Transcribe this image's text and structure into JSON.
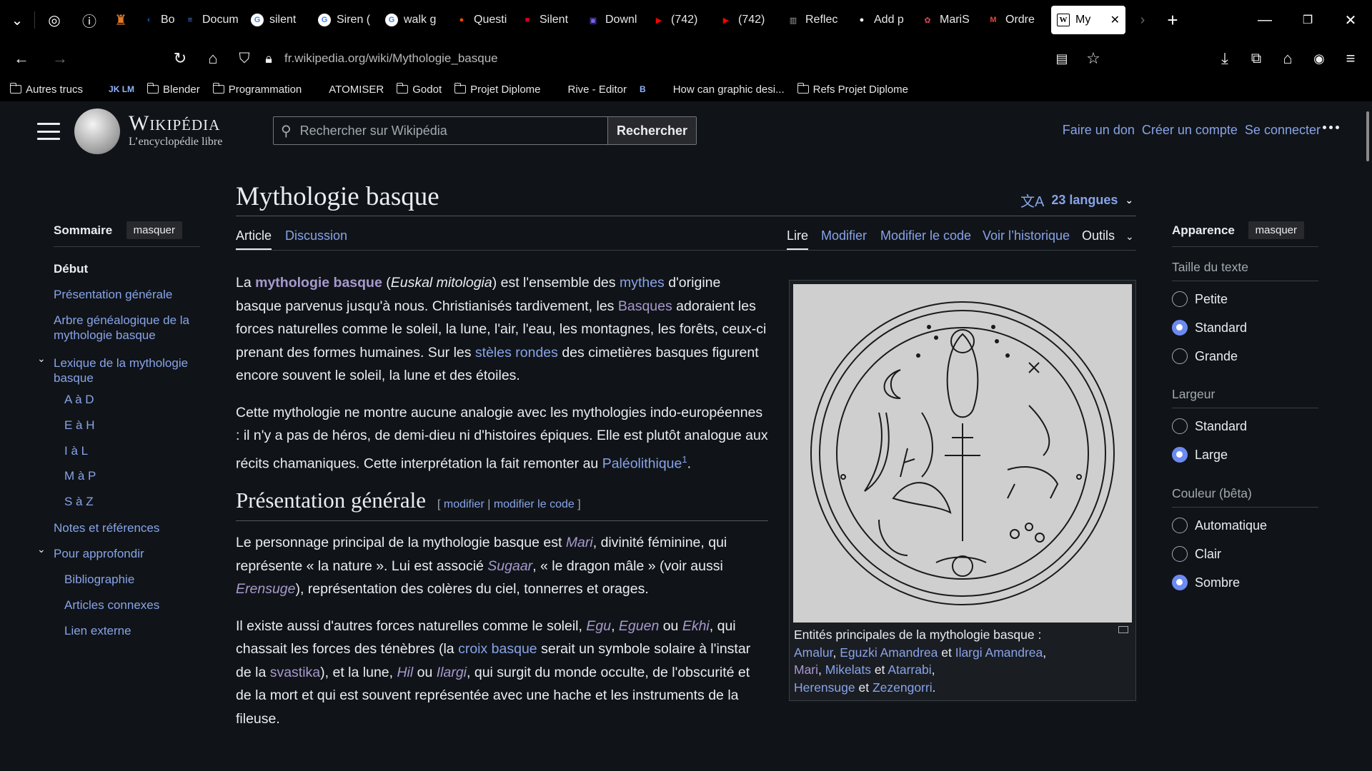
{
  "browser": {
    "tabs": [
      {
        "label": "Bo",
        "icon": "chevron-left-icon",
        "color": "#1a73e8"
      },
      {
        "label": "Docum",
        "icon": "docs-icon",
        "color": "#4285f4"
      },
      {
        "label": "silent",
        "icon": "google-icon",
        "color": "#ffffff"
      },
      {
        "label": "Siren (",
        "icon": "google-icon",
        "color": "#ffffff"
      },
      {
        "label": "walk g",
        "icon": "google-icon",
        "color": "#ffffff"
      },
      {
        "label": "Questi",
        "icon": "reddit-icon",
        "color": "#ff4500"
      },
      {
        "label": "Silent",
        "icon": "red-square-icon",
        "color": "#d0021b"
      },
      {
        "label": "Downl",
        "icon": "download-site-icon",
        "color": "#7b61ff"
      },
      {
        "label": "(742)",
        "icon": "youtube-icon",
        "color": "#ff0000"
      },
      {
        "label": "(742) ",
        "icon": "youtube-icon",
        "color": "#ff0000"
      },
      {
        "label": "Reflec",
        "icon": "reflect-icon",
        "color": "#9aa0a6"
      },
      {
        "label": "Add p",
        "icon": "github-icon",
        "color": "#ffffff"
      },
      {
        "label": "MariS",
        "icon": "flower-icon",
        "color": "#e04b5a"
      },
      {
        "label": "Ordre",
        "icon": "gmail-icon",
        "color": "#ea4335"
      }
    ],
    "active_tab": {
      "label": "My",
      "icon": "wikipedia-icon"
    },
    "url_domain": "fr.wikipedia.org",
    "url_path": "/wiki/Mythologie_basque",
    "bookmarks": [
      {
        "label": "Autres trucs",
        "type": "folder"
      },
      {
        "label": "",
        "type": "icon"
      },
      {
        "label": "JK LM",
        "type": "icon"
      },
      {
        "label": "Blender",
        "type": "folder"
      },
      {
        "label": "Programmation",
        "type": "folder"
      },
      {
        "label": "ATOMISER",
        "type": "link"
      },
      {
        "label": "Godot",
        "type": "folder"
      },
      {
        "label": "Projet Diplome",
        "type": "folder"
      },
      {
        "label": "Rive - Editor",
        "type": "link"
      },
      {
        "label": "B",
        "type": "icon"
      },
      {
        "label": "How can graphic desi...",
        "type": "link"
      },
      {
        "label": "Refs Projet Diplome",
        "type": "folder"
      }
    ]
  },
  "wiki": {
    "wordmark": "Wikipédia",
    "tagline": "L’encyclopédie libre",
    "search_placeholder": "Rechercher sur Wikipédia",
    "search_button": "Rechercher",
    "user_links": [
      "Faire un don",
      "Créer un compte",
      "Se connecter"
    ]
  },
  "toc": {
    "title": "Sommaire",
    "hide": "masquer",
    "items": [
      {
        "label": "Début",
        "level": 0,
        "current": true
      },
      {
        "label": "Présentation générale",
        "level": 0
      },
      {
        "label": "Arbre généalogique de la mythologie basque",
        "level": 0
      },
      {
        "label": "Lexique de la mythologie basque",
        "level": 0,
        "expandable": true
      },
      {
        "label": "A à D",
        "level": 1
      },
      {
        "label": "E à H",
        "level": 1
      },
      {
        "label": "I à L",
        "level": 1
      },
      {
        "label": "M à P",
        "level": 1
      },
      {
        "label": "S à Z",
        "level": 1
      },
      {
        "label": "Notes et références",
        "level": 0
      },
      {
        "label": "Pour approfondir",
        "level": 0,
        "expandable": true
      },
      {
        "label": "Bibliographie",
        "level": 1
      },
      {
        "label": "Articles connexes",
        "level": 1
      },
      {
        "label": "Lien externe",
        "level": 1
      }
    ]
  },
  "article": {
    "title": "Mythologie basque",
    "languages": "23 langues",
    "tabs_left": [
      "Article",
      "Discussion"
    ],
    "tabs_right": [
      "Lire",
      "Modifier",
      "Modifier le code",
      "Voir l’historique",
      "Outils"
    ],
    "p1": {
      "a": "La ",
      "b": "mythologie basque",
      "c": " (",
      "d": "Euskal mitologia",
      "e": ") est l'ensemble des ",
      "f": "mythes",
      "g": " d'origine basque parvenus jusqu'à nous. Christianisés tardivement, les ",
      "h": "Basques",
      "i": " adoraient les forces naturelles comme le soleil, la lune, l'air, l'eau, les montagnes, les forêts, ceux-ci prenant des formes humaines. Sur les ",
      "j": "stèles rondes",
      "k": " des cimetières basques figurent encore souvent le soleil, la lune et des étoiles."
    },
    "p2": {
      "a": "Cette mythologie ne montre aucune analogie avec les mythologies indo-européennes : il n'y a pas de héros, de demi-dieu ni d'histoires épiques. Elle est plutôt analogue aux récits chamaniques. Cette interprétation la fait remonter au ",
      "b": "Paléolithique",
      "c": "1",
      "d": "."
    },
    "section": {
      "title": "Présentation générale",
      "edit_open": "[ ",
      "edit1": "modifier",
      "edit_sep": " | ",
      "edit2": "modifier le code",
      "edit_close": " ]"
    },
    "p3": {
      "a": "Le personnage principal de la mythologie basque est ",
      "b": "Mari",
      "c": ", divinité féminine, qui représente « la nature ». Lui est associé ",
      "d": "Sugaar",
      "e": ", « le dragon mâle » (voir aussi ",
      "f": "Erensuge",
      "g": "), représentation des colères du ciel, tonnerres et orages."
    },
    "p4": {
      "a": "Il existe aussi d'autres forces naturelles comme le soleil, ",
      "b": "Egu",
      "c": ", ",
      "d": "Eguen",
      "e": " ou ",
      "f": "Ekhi",
      "g": ", qui chassait les forces des ténèbres (la ",
      "h": "croix basque",
      "i": " serait un symbole solaire à l'instar de la ",
      "j": "svastika",
      "k": "), et la lune, ",
      "l": "Hil",
      "m": " ou ",
      "n": "Ilargi",
      "o": ", qui surgit du monde occulte, de l'obscurité et de la mort et qui est souvent représentée avec une hache et les instruments de la fileuse."
    },
    "caption": {
      "a": "Entités principales de la mythologie basque :",
      "b": "Amalur",
      "c": ", ",
      "d": "Eguzki Amandrea",
      "e": " et ",
      "f": "Ilargi Amandrea",
      "g": ",",
      "h": "Mari",
      "i": ", ",
      "j": "Mikelats",
      "k": " et ",
      "l": "Atarrabi",
      "m": ",",
      "n": "Herensuge",
      "o": " et ",
      "p": "Zezengorri",
      "q": "."
    }
  },
  "appearance": {
    "title": "Apparence",
    "hide": "masquer",
    "groups": [
      {
        "label": "Taille du texte",
        "options": [
          "Petite",
          "Standard",
          "Grande"
        ],
        "selected": "Standard"
      },
      {
        "label": "Largeur",
        "options": [
          "Standard",
          "Large"
        ],
        "selected": "Large"
      },
      {
        "label": "Couleur (bêta)",
        "options": [
          "Automatique",
          "Clair",
          "Sombre"
        ],
        "selected": "Sombre"
      }
    ]
  },
  "colors": {
    "link": "#88a3e8",
    "visited": "#a799cd",
    "background": "#101418",
    "radio_on": "#6d8af1"
  }
}
